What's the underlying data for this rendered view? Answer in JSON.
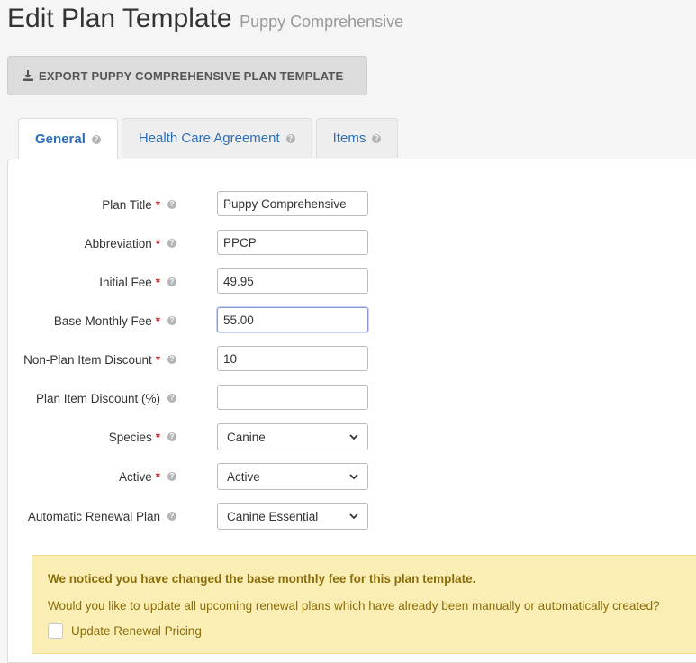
{
  "header": {
    "title": "Edit Plan Template",
    "subtitle": "Puppy Comprehensive"
  },
  "export_button": {
    "icon": "download-icon",
    "label": "EXPORT PUPPY COMPREHENSIVE PLAN TEMPLATE"
  },
  "tabs": [
    {
      "label": "General",
      "active": true
    },
    {
      "label": "Health Care Agreement",
      "active": false
    },
    {
      "label": "Items",
      "active": false
    }
  ],
  "help_glyph": "?",
  "required_mark": "*",
  "form": {
    "plan_title": {
      "label": "Plan Title",
      "value": "Puppy Comprehensive"
    },
    "abbreviation": {
      "label": "Abbreviation",
      "value": "PPCP"
    },
    "initial_fee": {
      "label": "Initial Fee",
      "value": "49.95"
    },
    "base_monthly_fee": {
      "label": "Base Monthly Fee",
      "value": "55.00"
    },
    "non_plan_item_discount": {
      "label": "Non-Plan Item Discount",
      "value": "10"
    },
    "plan_item_discount": {
      "label": "Plan Item Discount (%)",
      "value": ""
    },
    "species": {
      "label": "Species",
      "selected": "Canine"
    },
    "active": {
      "label": "Active",
      "selected": "Active"
    },
    "automatic_renewal_plan": {
      "label": "Automatic Renewal Plan",
      "selected": "Canine Essential"
    }
  },
  "notice": {
    "title": "We noticed you have changed the base monthly fee for this plan template.",
    "question": "Would you like to update all upcoming renewal plans which have already been manually or automatically created?",
    "checkbox_label": "Update Renewal Pricing",
    "checked": false
  },
  "colors": {
    "link_blue": "#2a6fb7",
    "required_red": "#c0282d",
    "notice_bg": "#fbeeb4",
    "notice_text": "#8a6d0b"
  }
}
